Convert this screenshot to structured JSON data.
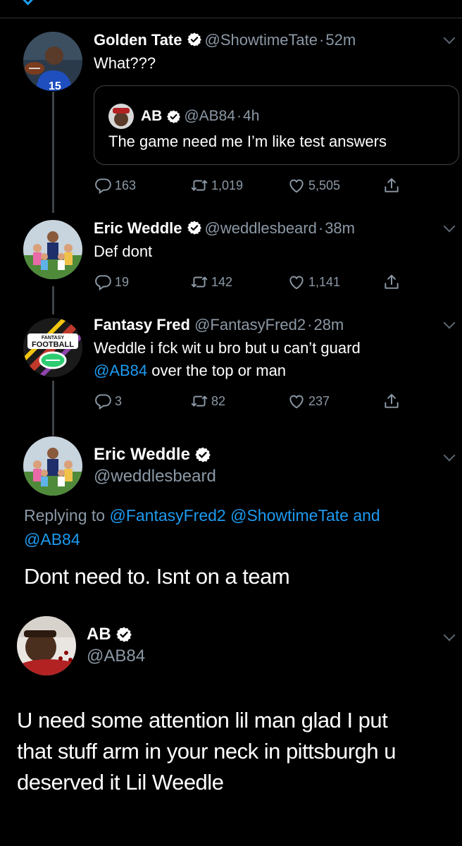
{
  "tweets": [
    {
      "name": "Golden Tate",
      "handle": "@ShowtimeTate",
      "time": "52m",
      "text": "What???",
      "quoted": {
        "name": "AB",
        "handle": "@AB84",
        "time": "4h",
        "text": "The game need me I’m like test answers"
      },
      "replies": "163",
      "retweets": "1,019",
      "likes": "5,505"
    },
    {
      "name": "Eric Weddle",
      "handle": "@weddlesbeard",
      "time": "38m",
      "text": "Def dont",
      "replies": "19",
      "retweets": "142",
      "likes": "1,141"
    },
    {
      "name": "Fantasy Fred",
      "handle": "@FantasyFred2",
      "time": "28m",
      "text_line1": "Weddle i fck wit u bro but u can’t guard",
      "text_mention": "@AB84",
      "text_line2_rest": " over the top or man",
      "replies": "3",
      "retweets": "82",
      "likes": "237",
      "avatar_label": "FANTASY FOOTBALL"
    }
  ],
  "focused": {
    "name": "Eric Weddle",
    "handle": "@weddlesbeard",
    "replying_prefix": "Replying to ",
    "replying_1": "@FantasyFred2",
    "replying_2": "@ShowtimeTate",
    "replying_and": "and",
    "replying_3": "@AB84",
    "text": "Dont need to. Isnt on a team"
  },
  "reply": {
    "name": "AB",
    "handle": "@AB84",
    "text_line1": "U need some attention lil man glad I put",
    "text_line2": "that stuff arm in your neck in pittsburgh u",
    "text_line3": "deserved it Lil Weedle"
  },
  "colors": {
    "background": "#000000",
    "link": "#1d9bf0",
    "muted": "#8b98a5",
    "verified": "#ffffff"
  }
}
